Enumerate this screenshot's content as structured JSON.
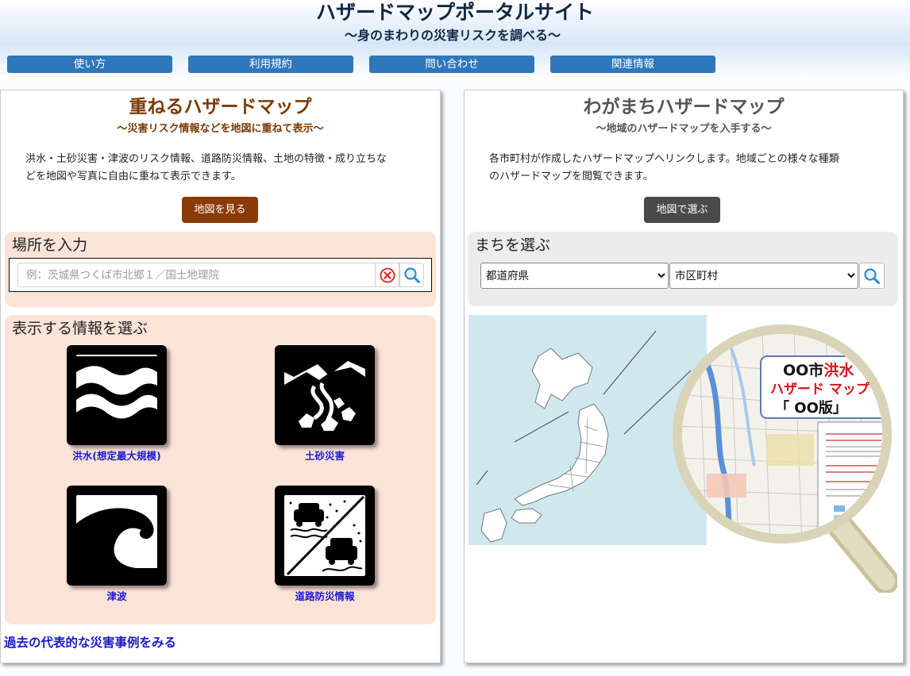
{
  "header": {
    "title": "ハザードマップポータルサイト",
    "subtitle": "〜身のまわりの災害リスクを調べる〜",
    "nav": [
      "使い方",
      "利用規約",
      "問い合わせ",
      "関連情報"
    ]
  },
  "left": {
    "title": "重ねるハザードマップ",
    "subtitle": "〜災害リスク情報などを地図に重ねて表示〜",
    "description_lines": [
      "洪水・土砂災害・津波のリスク情報、道路防災情報、土地の特徴・成り立ちな",
      "どを地図や写真に自由に重ねて表示できます。"
    ],
    "button": "地図を見る",
    "location_box": {
      "title": "場所を入力",
      "placeholder": "例：茨城県つくば市北郷１／国土地理院"
    },
    "info_box": {
      "title": "表示する情報を選ぶ",
      "items": [
        "洪水(想定最大規模)",
        "土砂災害",
        "津波",
        "道路防災情報"
      ]
    },
    "past_link": "過去の代表的な災害事例をみる"
  },
  "right": {
    "title": "わがまちハザードマップ",
    "subtitle": "〜地域のハザードマップを入手する〜",
    "description_lines": [
      "各市町村が作成したハザードマップへリンクします。地域ごとの様々な種類",
      "のハザードマップを閲覧できます。"
    ],
    "button": "地図で選ぶ",
    "town_box": {
      "title": "まちを選ぶ",
      "prefecture_select": "都道府県",
      "city_select": "市区町村"
    },
    "illustration_text": {
      "line1_black": "OO市",
      "line1_red": "洪水",
      "line2": "ハザード マップ",
      "line3": "「 OO版」"
    }
  },
  "colors": {
    "nav_button": "#2f77bb",
    "left_title": "#7a3b06",
    "left_button": "#8b3a06",
    "right_title": "#555555",
    "right_button": "#4a4a4a",
    "peach_box": "#fbe3d8",
    "gray_box": "#ececec",
    "link": "#1a1acd"
  }
}
